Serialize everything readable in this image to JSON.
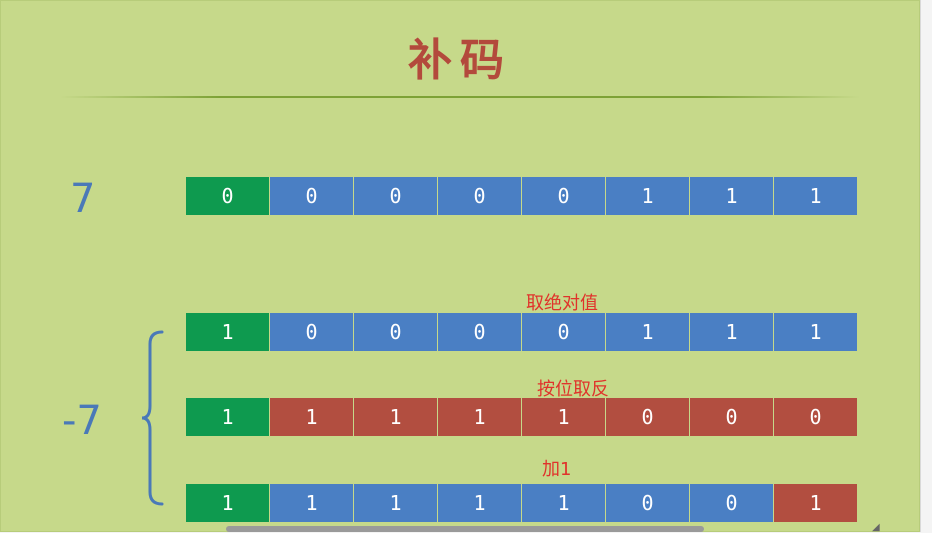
{
  "title": "补码",
  "colors": {
    "sign_bit": "#0e9a4f",
    "bit_blue": "#4a7fc4",
    "bit_red": "#b24e40",
    "note": "#e0332b",
    "label": "#4a79b8"
  },
  "labels": {
    "positive": "7",
    "negative": "-7"
  },
  "notes": {
    "abs": "取绝对值",
    "invert": "按位取反",
    "add_one": "加1"
  },
  "rows": [
    {
      "bits": [
        "0",
        "0",
        "0",
        "0",
        "0",
        "1",
        "1",
        "1"
      ],
      "colors": [
        "sign_bit",
        "bit_blue",
        "bit_blue",
        "bit_blue",
        "bit_blue",
        "bit_blue",
        "bit_blue",
        "bit_blue"
      ]
    },
    {
      "bits": [
        "1",
        "0",
        "0",
        "0",
        "0",
        "1",
        "1",
        "1"
      ],
      "colors": [
        "sign_bit",
        "bit_blue",
        "bit_blue",
        "bit_blue",
        "bit_blue",
        "bit_blue",
        "bit_blue",
        "bit_blue"
      ]
    },
    {
      "bits": [
        "1",
        "1",
        "1",
        "1",
        "1",
        "0",
        "0",
        "0"
      ],
      "colors": [
        "sign_bit",
        "bit_red",
        "bit_red",
        "bit_red",
        "bit_red",
        "bit_red",
        "bit_red",
        "bit_red"
      ]
    },
    {
      "bits": [
        "1",
        "1",
        "1",
        "1",
        "1",
        "0",
        "0",
        "1"
      ],
      "colors": [
        "sign_bit",
        "bit_blue",
        "bit_blue",
        "bit_blue",
        "bit_blue",
        "bit_blue",
        "bit_blue",
        "bit_red"
      ]
    }
  ]
}
